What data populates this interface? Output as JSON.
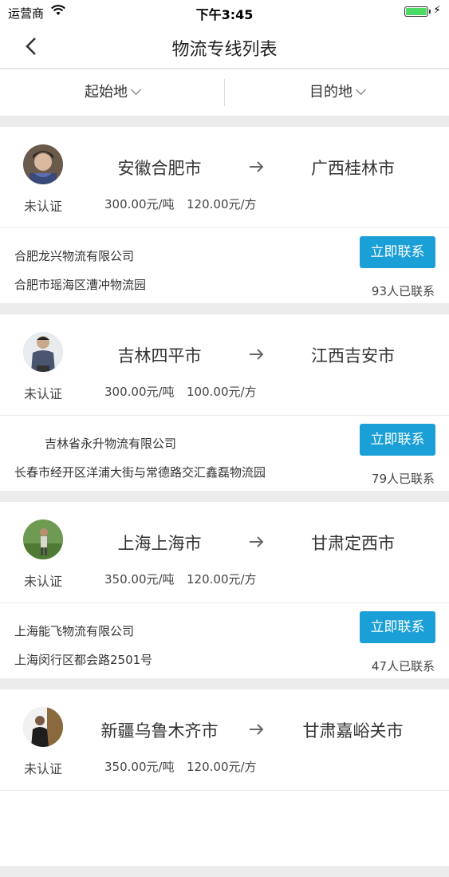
{
  "status_bar": {
    "carrier": "运营商",
    "time": "下午3:45"
  },
  "nav": {
    "title": "物流专线列表"
  },
  "filters": {
    "origin_label": "起始地",
    "dest_label": "目的地"
  },
  "routes": [
    {
      "origin": "安徽合肥市",
      "dest": "广西桂林市",
      "status": "未认证",
      "price_ton": "300.00元/吨",
      "price_cube": "120.00元/方",
      "company": "合肥龙兴物流有限公司",
      "address": "合肥市瑶海区漕冲物流园",
      "contact_label": "立即联系",
      "contacted": "93人已联系"
    },
    {
      "origin": "吉林四平市",
      "dest": "江西吉安市",
      "status": "未认证",
      "price_ton": "300.00元/吨",
      "price_cube": "100.00元/方",
      "company": "吉林省永升物流有限公司",
      "address": "长春市经开区洋浦大街与常德路交汇鑫磊物流园",
      "contact_label": "立即联系",
      "contacted": "79人已联系"
    },
    {
      "origin": "上海上海市",
      "dest": "甘肃定西市",
      "status": "未认证",
      "price_ton": "350.00元/吨",
      "price_cube": "120.00元/方",
      "company": "上海能飞物流有限公司",
      "address": "上海闵行区都会路2501号",
      "contact_label": "立即联系",
      "contacted": "47人已联系"
    },
    {
      "origin": "新疆乌鲁木齐市",
      "dest": "甘肃嘉峪关市",
      "status": "未认证",
      "price_ton": "350.00元/吨",
      "price_cube": "120.00元/方"
    }
  ],
  "colors": {
    "accent": "#1a9fd6",
    "battery": "#4cd964",
    "background": "#ececec"
  }
}
